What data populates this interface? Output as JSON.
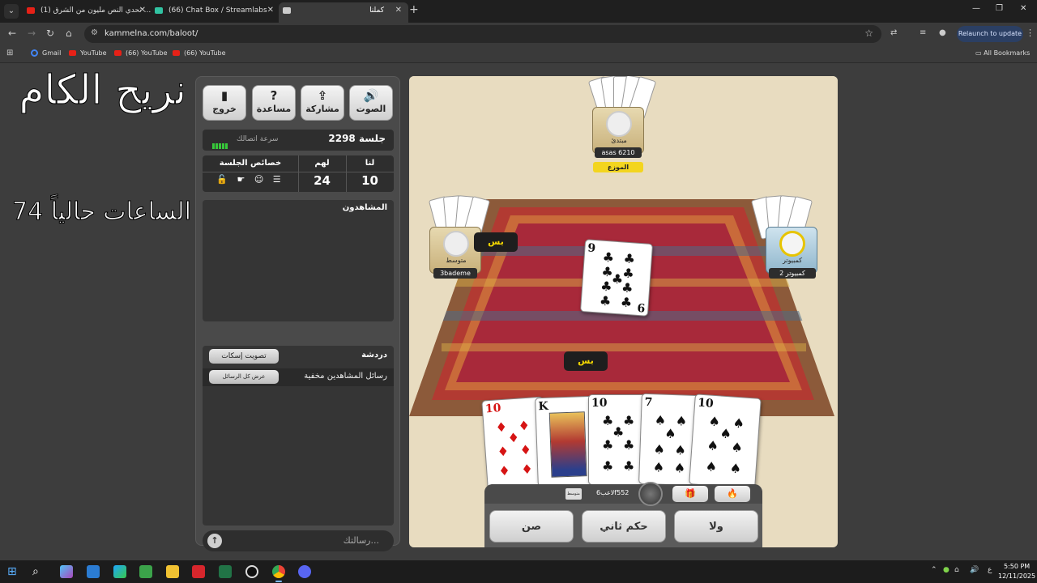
{
  "browser": {
    "tabs": [
      {
        "title": "(1) تحدي النص مليون من الشرق ...",
        "favicon_color": "#e62117",
        "active": false
      },
      {
        "title": "(66) Chat Box / Streamlabs",
        "favicon_color": "#31c3a2",
        "active": false
      },
      {
        "title": "كملنا",
        "favicon_color": "#cccccc",
        "active": true
      }
    ],
    "url": "kammelna.com/baloot/",
    "relaunch_label": "Relaunch to update",
    "bookmarks": [
      "Gmail",
      "YouTube",
      "(66) YouTube",
      "(66) YouTube"
    ],
    "all_bookmarks_label": "All Bookmarks"
  },
  "overlay": {
    "title": "نريح الكام",
    "hours_text": "عدد الساعات حالياً 74"
  },
  "panel": {
    "buttons": [
      {
        "label": "الصوت",
        "icon": "🔊",
        "name": "sound-button",
        "icon_name": "speaker-icon"
      },
      {
        "label": "مشاركة",
        "icon": "⇪",
        "name": "share-button",
        "icon_name": "share-icon"
      },
      {
        "label": "مساعدة",
        "icon": "?",
        "name": "help-button",
        "icon_name": "help-icon"
      },
      {
        "label": "خروج",
        "icon": "▮",
        "name": "exit-button",
        "icon_name": "door-icon"
      }
    ],
    "session_label": "جلسة 2298",
    "connection_label": "سرعة اتصالك",
    "score": {
      "us_label": "لنا",
      "us_value": "10",
      "them_label": "لهم",
      "them_value": "24",
      "props_label": "خصائص الجلسة",
      "props_icons": "🔓 ☛ ☺ ☰"
    },
    "watchers_title": "المشاهدون",
    "chat_title": "دردشة",
    "mute_label": "تصويت إسكات",
    "hidden_msgs_label": "رسائل المشاهدين مخفية",
    "show_all_label": "عرض كل الرسائل",
    "message_placeholder": "رسالتك..."
  },
  "game": {
    "top_player": {
      "level": "مبتدئ",
      "name": "asas 6210",
      "role": "الموزع"
    },
    "left_player": {
      "level": "متوسط",
      "name": "3bademe",
      "bid": "بس"
    },
    "right_player": {
      "level": "كمبيوتر",
      "name": "كمبيوتر 2"
    },
    "self_bid": "بس",
    "center_card": {
      "rank": "9",
      "suit": "♣",
      "color": "black"
    },
    "hand": [
      {
        "rank": "10",
        "suit": "♦",
        "color": "red"
      },
      {
        "rank": "K",
        "suit": "♣",
        "color": "black"
      },
      {
        "rank": "10",
        "suit": "♣",
        "color": "black"
      },
      {
        "rank": "7",
        "suit": "♠",
        "color": "black"
      },
      {
        "rank": "10",
        "suit": "♠",
        "color": "black"
      }
    ],
    "self": {
      "name": "لاعب6f552",
      "level": "متوسط"
    },
    "actions": [
      "صن",
      "حكم ثاني",
      "ولا"
    ]
  },
  "taskbar": {
    "time": "5:50 PM",
    "date": "12/11/2025",
    "lang": "ع"
  }
}
